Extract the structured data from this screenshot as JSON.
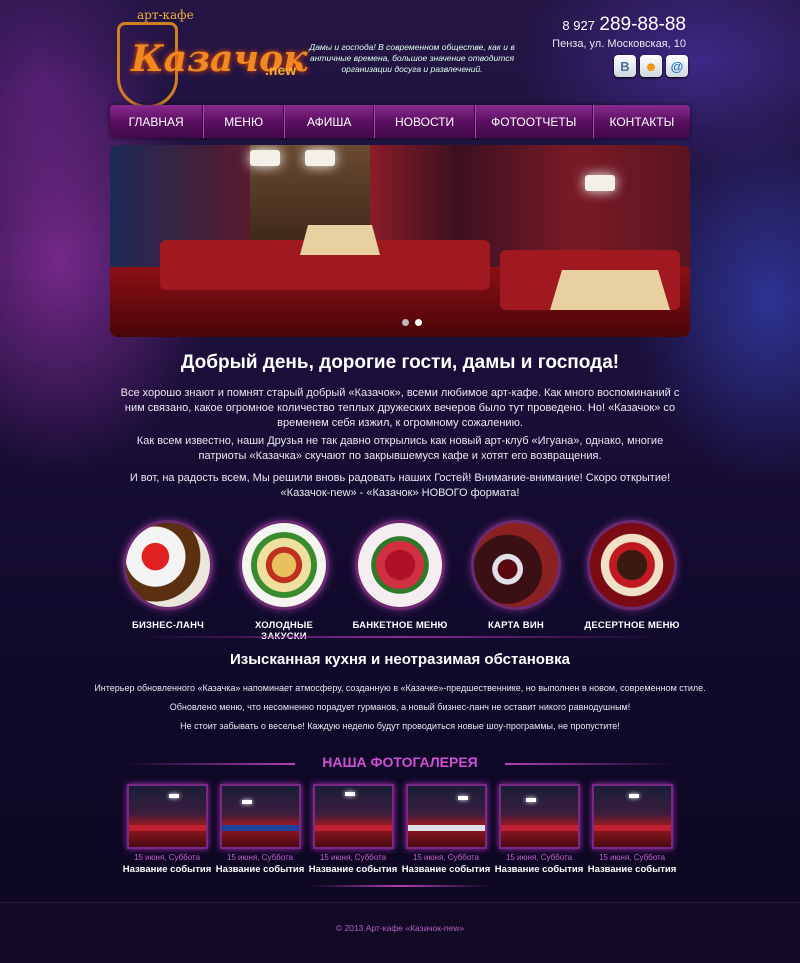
{
  "header": {
    "logo_small": "арт-кафе",
    "logo_name": "Казачок",
    "logo_suffix": ".new",
    "tagline": "Дамы и господа! В современном обществе, как и в античные времена, большое значение отводится организации досуга и развлечений.",
    "phone_prefix": "8 927",
    "phone_number": "289-88-88",
    "address": "Пенза, ул. Московская, 10",
    "socials": [
      {
        "icon": "vk-icon",
        "glyph": "В",
        "color": "#4a6e9c"
      },
      {
        "icon": "odnoklassniki-icon",
        "glyph": "☻",
        "color": "#f39200"
      },
      {
        "icon": "mail-icon",
        "glyph": "@",
        "color": "#1a73c8"
      }
    ]
  },
  "nav": [
    "ГЛАВНАЯ",
    "МЕНЮ",
    "АФИША",
    "НОВОСТИ",
    "ФОТООТЧЕТЫ",
    "КОНТАКТЫ"
  ],
  "welcome": {
    "title": "Добрый день, дорогие гости, дамы и господа!",
    "p1": "Все хорошо знают и помнят старый добрый «Казачок», всеми любимое арт-кафе. Как много воспоминаний с ним связано, какое огромное количество теплых дружеских вечеров было тут проведено. Но! «Казачок» со временем себя изжил, к огромному сожалению.",
    "p2": "Как всем известно, наши Друзья не так давно открылись как новый арт-клуб «Игуана», однако, многие патриоты «Казачка» скучают по закрывшемуся кафе и хотят его возвращения.",
    "p3": "И вот, на радость всем, Мы решили вновь радовать наших Гостей! Внимание-внимание! Скоро открытие! «Казачок-new» - «Казачок» НОВОГО формата!"
  },
  "categories": [
    "БИЗНЕС-ЛАНЧ",
    "ХОЛОДНЫЕ ЗАКУСКИ",
    "БАНКЕТНОЕ МЕНЮ",
    "КАРТА ВИН",
    "ДЕСЕРТНОЕ МЕНЮ"
  ],
  "cuisine": {
    "title": "Изысканная кухня и неотразимая обстановка",
    "p1": "Интерьер обновленного «Казачка» напоминает атмосферу, созданную в «Казачке»-предшественнике, но выполнен в новом, современном стиле.",
    "p2": "Обновлено меню, что несомненно порадует гурманов, а новый бизнес-ланч не оставит никого равнодушным!",
    "p3": "Не стоит забывать о веселье! Каждую неделю будут проводиться новые шоу-программы, не пропустите!"
  },
  "gallery": {
    "title": "НАША ФОТОГАЛЕРЕЯ",
    "items": [
      {
        "date": "15 июня, Суббота",
        "name": "Название события"
      },
      {
        "date": "15 июня, Суббота",
        "name": "Название события"
      },
      {
        "date": "15 июня, Суббота",
        "name": "Название события"
      },
      {
        "date": "15 июня, Суббота",
        "name": "Название события"
      },
      {
        "date": "15 июня, Суббота",
        "name": "Название события"
      },
      {
        "date": "15 июня, Суббота",
        "name": "Название события"
      }
    ]
  },
  "footer": "© 2013 Арт-кафе «Казачок-new»",
  "colors": {
    "accent": "#d050d8",
    "nav": "#6a1a70"
  }
}
